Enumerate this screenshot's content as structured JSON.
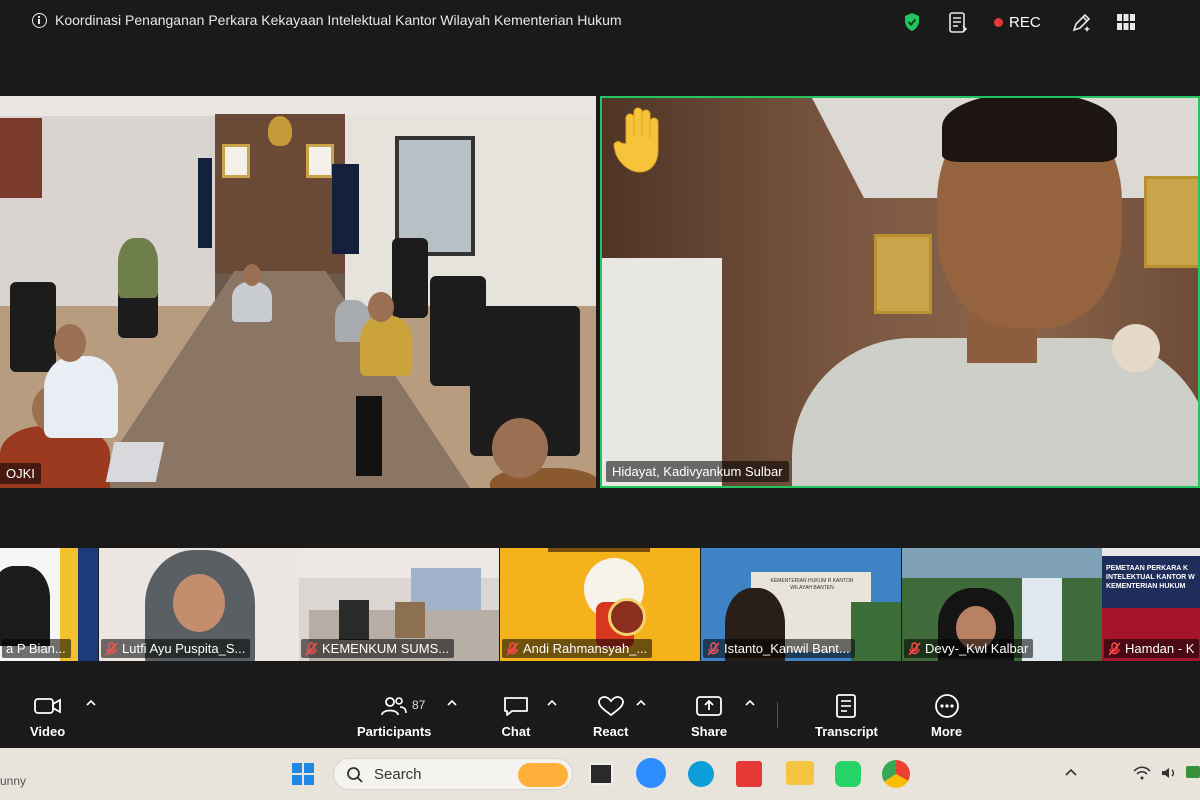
{
  "meeting": {
    "title": "Koordinasi Penanganan Perkara Kekayaan Intelektual Kantor Wilayah Kementerian Hukum",
    "rec_label": "REC"
  },
  "colors": {
    "accent_green": "#22c55e",
    "rec_red": "#e53935",
    "shield_green": "#22c55e"
  },
  "tiles": {
    "left_label": "OJKI",
    "right_label": "Hidayat, Kadivyankum Sulbar"
  },
  "thumbnails": [
    {
      "label": "a P Bian...",
      "muted": false
    },
    {
      "label": "Lutfi Ayu Puspita_S...",
      "muted": true
    },
    {
      "label": "KEMENKUM SUMS...",
      "muted": true
    },
    {
      "label": "Andi Rahmansyah_...",
      "muted": true
    },
    {
      "label": "Istanto_Kanwil Bant...",
      "muted": true
    },
    {
      "label": "Devy-_Kwl Kalbar",
      "muted": true
    },
    {
      "label": "Hamdan - K",
      "muted": true
    }
  ],
  "thumb_texts": {
    "slide_title": "PEMETAAN PERKARA K INTELEKTUAL KANTOR W KEMENTERIAN HUKUM",
    "building_sign": "KEMENTERIAN HUKUM R KANTOR WILAYAH BANTEN"
  },
  "controls": {
    "video": "Video",
    "participants": "Participants",
    "participants_count": "87",
    "chat": "Chat",
    "react": "React",
    "share": "Share",
    "transcript": "Transcript",
    "more": "More"
  },
  "taskbar": {
    "weather": "unny",
    "search_placeholder": "Search"
  },
  "icons": {
    "meeting_info": "info-icon",
    "security": "shield-icon",
    "notes": "document-icon",
    "annotate": "pen-icon",
    "view": "grid-view-icon",
    "raised_hand": "raised-hand-icon"
  }
}
